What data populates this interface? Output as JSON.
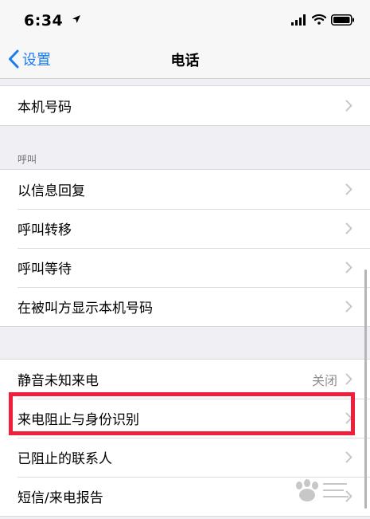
{
  "status_bar": {
    "time": "6:34"
  },
  "nav": {
    "back_label": "设置",
    "title": "电话"
  },
  "group1": {
    "items": [
      {
        "label": "本机号码"
      }
    ]
  },
  "calls_section": {
    "header": "呼叫",
    "items": [
      {
        "label": "以信息回复"
      },
      {
        "label": "呼叫转移"
      },
      {
        "label": "呼叫等待"
      },
      {
        "label": "在被叫方显示本机号码"
      }
    ]
  },
  "group3": {
    "items": [
      {
        "label": "静音未知来电",
        "value": "关闭"
      },
      {
        "label": "来电阻止与身份识别"
      },
      {
        "label": "已阻止的联系人"
      },
      {
        "label": "短信/来电报告"
      }
    ]
  },
  "colors": {
    "accent": "#1a7cf5",
    "highlight": "#f0203d",
    "background": "#efeff4"
  }
}
